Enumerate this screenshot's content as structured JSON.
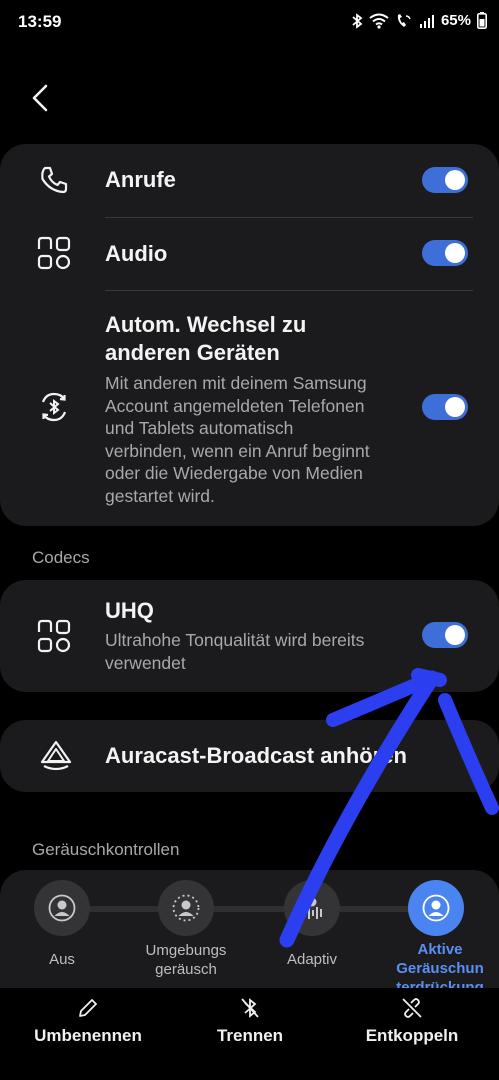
{
  "status": {
    "time": "13:59",
    "battery": "65%"
  },
  "connections": {
    "calls": {
      "label": "Anrufe",
      "enabled": true
    },
    "audio": {
      "label": "Audio",
      "enabled": true
    },
    "auto_switch": {
      "label_line1": "Autom. Wechsel zu",
      "label_line2": "anderen Geräten",
      "desc_lines": [
        "Mit anderen mit deinem Samsung",
        "Account angemeldeten Telefonen",
        "und Tablets automatisch",
        "verbinden, wenn ein Anruf beginnt",
        "oder die Wiedergabe von Medien",
        "gestartet wird."
      ],
      "enabled": true
    }
  },
  "codecs": {
    "section_label": "Codecs",
    "uhq": {
      "label": "UHQ",
      "desc_lines": [
        "Ultrahohe Tonqualität wird bereits",
        "verwendet"
      ],
      "enabled": true
    }
  },
  "auracast": {
    "label": "Auracast-Broadcast anhören"
  },
  "noise_controls": {
    "section_label": "Geräuschkontrollen",
    "options": [
      {
        "lines": [
          "Aus"
        ]
      },
      {
        "lines": [
          "Umgebungs",
          "geräusch"
        ]
      },
      {
        "lines": [
          "Adaptiv"
        ]
      },
      {
        "lines": [
          "Aktive",
          "Geräuschun",
          "terdrückung"
        ]
      }
    ],
    "selected_index": 3
  },
  "bottom_actions": {
    "rename": "Umbenennen",
    "disconnect": "Trennen",
    "unpair": "Entkoppeln"
  },
  "colors": {
    "accent": "#4a84f0",
    "card": "#1b1b1d",
    "annotation": "#2b3ff0"
  },
  "icons": {
    "calls": "phone-icon",
    "audio": "apps-grid-icon",
    "auto_switch": "bluetooth-sync-icon",
    "uhq": "apps-grid-icon",
    "auracast": "auracast-icon"
  }
}
